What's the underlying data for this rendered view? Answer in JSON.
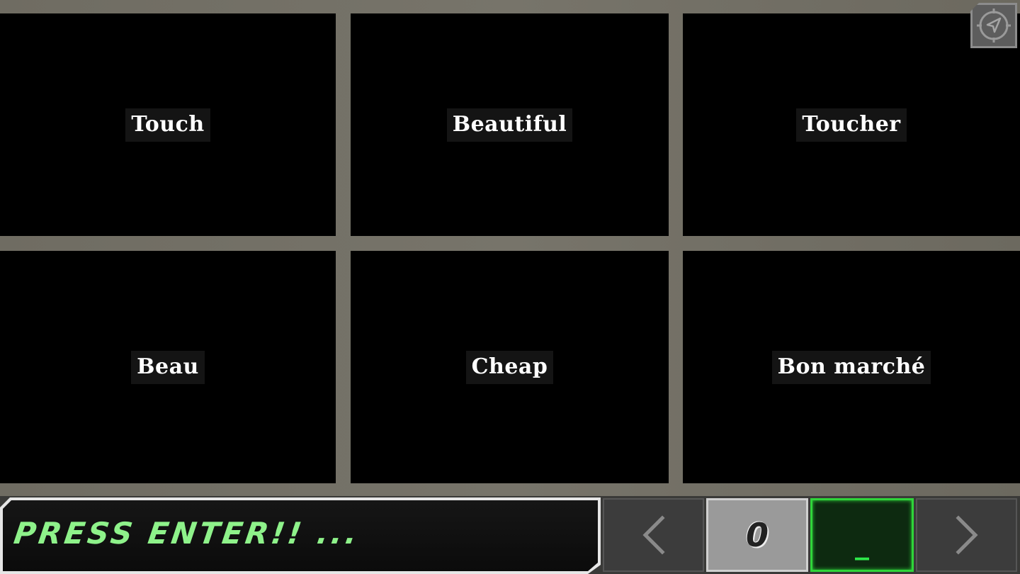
{
  "tiles": [
    {
      "label": "Touch"
    },
    {
      "label": "Beautiful"
    },
    {
      "label": "Toucher"
    },
    {
      "label": "Beau"
    },
    {
      "label": "Cheap"
    },
    {
      "label": "Bon marché"
    }
  ],
  "prompt": {
    "text": "PRESS ENTER!! ..."
  },
  "controls": {
    "prev_icon": "chevron-left-icon",
    "next_icon": "chevron-right-icon",
    "digit_value": "0",
    "active_value": "_"
  },
  "colors": {
    "prompt_green": "#8ef28a",
    "active_border": "#2fd53a",
    "tile_bg": "#000000",
    "frame": "#74716a"
  },
  "icons": {
    "top_right": "compass-navigation-icon"
  }
}
